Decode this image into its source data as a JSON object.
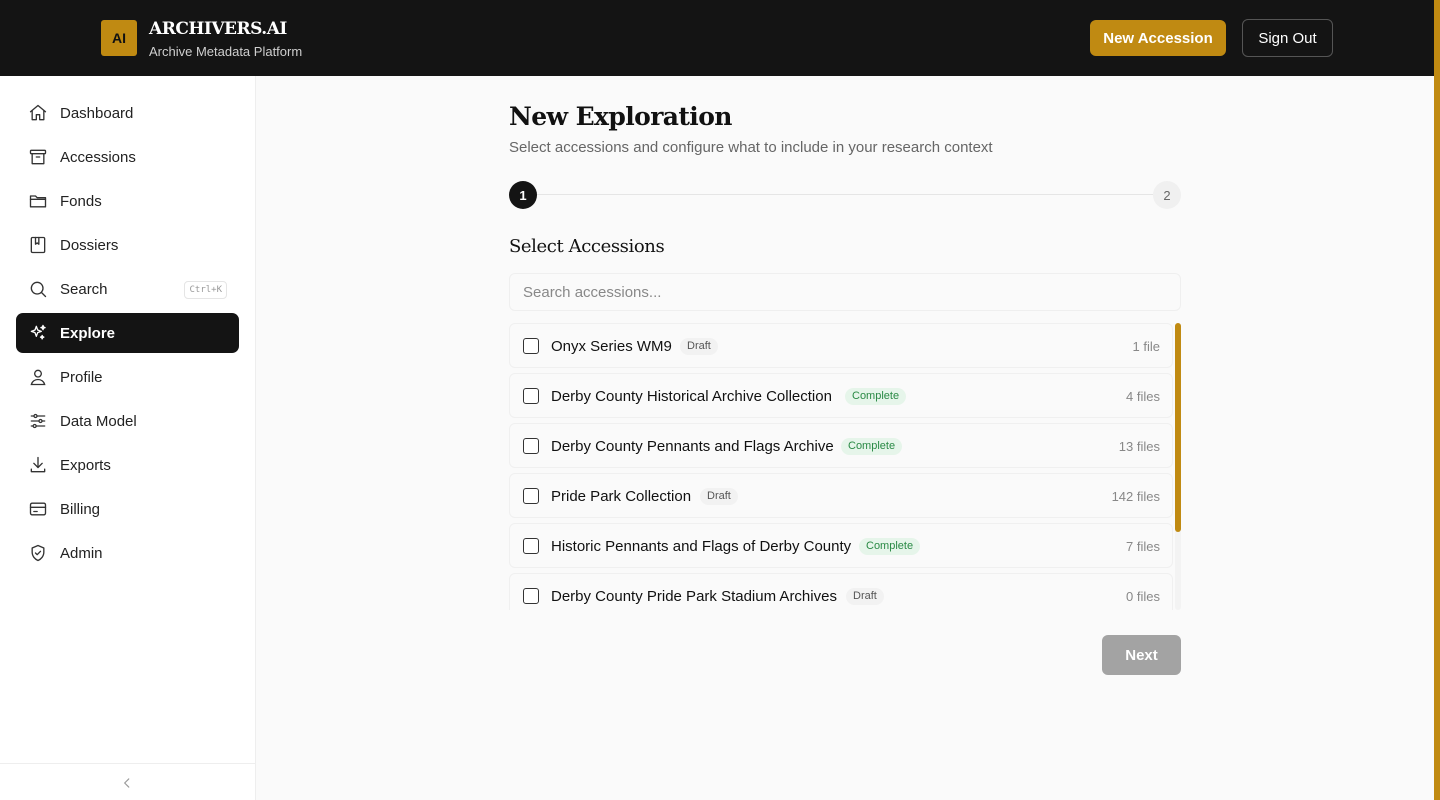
{
  "header": {
    "logo_text": "AI",
    "app_name": "ARCHIVERS.AI",
    "app_subtitle": "Archive Metadata Platform",
    "new_accession_label": "New Accession",
    "sign_out_label": "Sign Out"
  },
  "sidebar": {
    "items": [
      {
        "label": "Dashboard",
        "icon": "home-icon"
      },
      {
        "label": "Accessions",
        "icon": "archive-box-icon"
      },
      {
        "label": "Fonds",
        "icon": "folder-icon"
      },
      {
        "label": "Dossiers",
        "icon": "book-icon"
      },
      {
        "label": "Search",
        "icon": "search-icon",
        "shortcut": "Ctrl+K"
      },
      {
        "label": "Explore",
        "icon": "sparkles-icon",
        "active": true
      },
      {
        "label": "Profile",
        "icon": "user-icon"
      },
      {
        "label": "Data Model",
        "icon": "sliders-icon"
      },
      {
        "label": "Exports",
        "icon": "download-icon"
      },
      {
        "label": "Billing",
        "icon": "credit-card-icon"
      },
      {
        "label": "Admin",
        "icon": "shield-check-icon"
      }
    ],
    "collapse_icon": "chevron-left-icon"
  },
  "main": {
    "title": "New Exploration",
    "subtitle": "Select accessions and configure what to include in your research context",
    "steps": [
      "1",
      "2"
    ],
    "current_step": 1,
    "section_title": "Select Accessions",
    "search_placeholder": "Search accessions...",
    "accessions": [
      {
        "name": "Onyx Series WM9",
        "status": "Draft",
        "files": "1 file"
      },
      {
        "name": "Derby County Historical Archive Collection",
        "status": "Complete",
        "files": "4 files"
      },
      {
        "name": "Derby County Pennants and Flags Archive",
        "status": "Complete",
        "files": "13 files"
      },
      {
        "name": "Pride Park Collection",
        "status": "Draft",
        "files": "142 files"
      },
      {
        "name": "Historic Pennants and Flags of Derby County",
        "status": "Complete",
        "files": "7 files"
      },
      {
        "name": "Derby County Pride Park Stadium Archives",
        "status": "Draft",
        "files": "0 files"
      }
    ],
    "next_label": "Next"
  },
  "colors": {
    "accent": "#c08a12",
    "header_bg": "#141414",
    "complete_text": "#2a8a45",
    "complete_bg": "#e6f5ea",
    "disabled_button": "#a3a3a3"
  }
}
